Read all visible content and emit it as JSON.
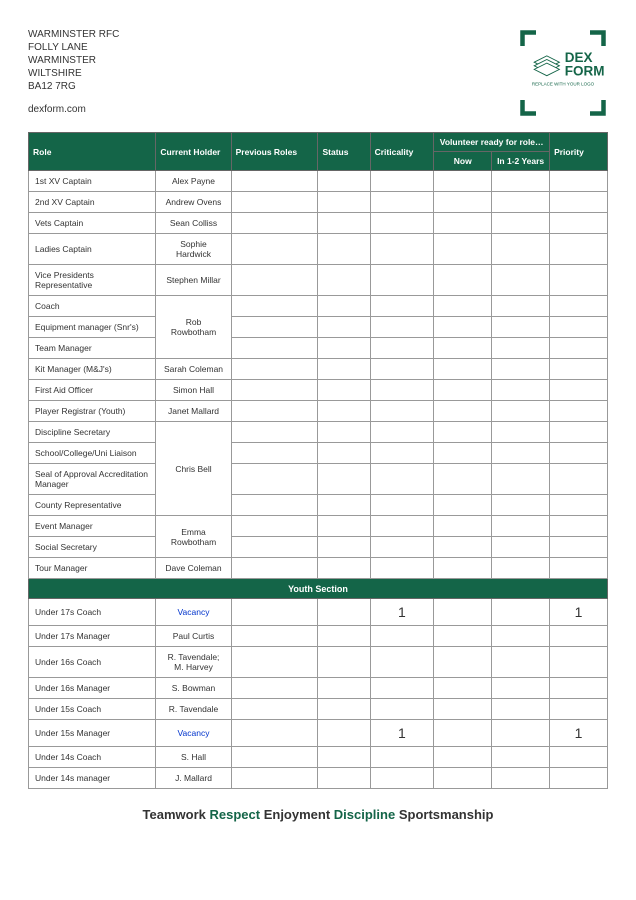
{
  "address": {
    "line1": "WARMINSTER RFC",
    "line2": "FOLLY LANE",
    "line3": "WARMINSTER",
    "line4": "WILTSHIRE",
    "line5": "BA12 7RG",
    "website": "dexform.com"
  },
  "logo": {
    "text1": "DEX",
    "text2": "FORM",
    "tagline": "REPLACE WITH YOUR LOGO"
  },
  "columns": {
    "role": "Role",
    "holder": "Current Holder",
    "prev": "Previous Roles",
    "status": "Status",
    "crit": "Criticality",
    "vol_header": "Volunteer ready for role…",
    "now": "Now",
    "years": "In 1-2 Years",
    "priority": "Priority"
  },
  "rows": [
    {
      "role": "1st XV Captain",
      "holder": "Alex Payne"
    },
    {
      "role": "2nd XV Captain",
      "holder": "Andrew Ovens"
    },
    {
      "role": "Vets Captain",
      "holder": "Sean Colliss"
    },
    {
      "role": "Ladies Captain",
      "holder": "Sophie Hardwick"
    },
    {
      "role": "Vice Presidents Representative",
      "holder": "Stephen Millar"
    },
    {
      "role": "Coach",
      "holder": "Rob Rowbotham",
      "mergeHolder": 3
    },
    {
      "role": "Equipment manager (Snr's)",
      "skipHolder": true
    },
    {
      "role": "Team Manager",
      "skipHolder": true
    },
    {
      "role": "Kit Manager (M&J's)",
      "holder": "Sarah Coleman"
    },
    {
      "role": "First Aid Officer",
      "holder": "Simon Hall"
    },
    {
      "role": "Player Registrar (Youth)",
      "holder": "Janet Mallard"
    },
    {
      "role": "Discipline Secretary",
      "holder": "Chris Bell",
      "mergeHolder": 4
    },
    {
      "role": "School/College/Uni Liaison",
      "skipHolder": true
    },
    {
      "role": "Seal of Approval Accreditation Manager",
      "skipHolder": true
    },
    {
      "role": "County Representative",
      "skipHolder": true
    },
    {
      "role": "Event Manager",
      "holder": "Emma Rowbotham",
      "mergeHolder": 2
    },
    {
      "role": "Social Secretary",
      "skipHolder": true
    },
    {
      "role": "Tour Manager",
      "holder": "Dave Coleman"
    }
  ],
  "youth_section": {
    "title": "Youth Section",
    "rows": [
      {
        "role": "Under 17s Coach",
        "holder": "Vacancy",
        "vacancy": true,
        "crit": "1",
        "priority": "1"
      },
      {
        "role": "Under 17s Manager",
        "holder": "Paul Curtis"
      },
      {
        "role": "Under 16s Coach",
        "holder": "R. Tavendale; M. Harvey"
      },
      {
        "role": "Under 16s Manager",
        "holder": "S. Bowman"
      },
      {
        "role": "Under 15s Coach",
        "holder": "R. Tavendale"
      },
      {
        "role": "Under 15s Manager",
        "holder": "Vacancy",
        "vacancy": true,
        "crit": "1",
        "priority": "1"
      },
      {
        "role": "Under 14s Coach",
        "holder": "S. Hall"
      },
      {
        "role": "Under 14s manager",
        "holder": "J. Mallard"
      }
    ]
  },
  "footer": {
    "w1": "Teamwork",
    "w2": "Respect",
    "w3": "Enjoyment",
    "w4": "Discipline",
    "w5": "Sportsmanship"
  }
}
